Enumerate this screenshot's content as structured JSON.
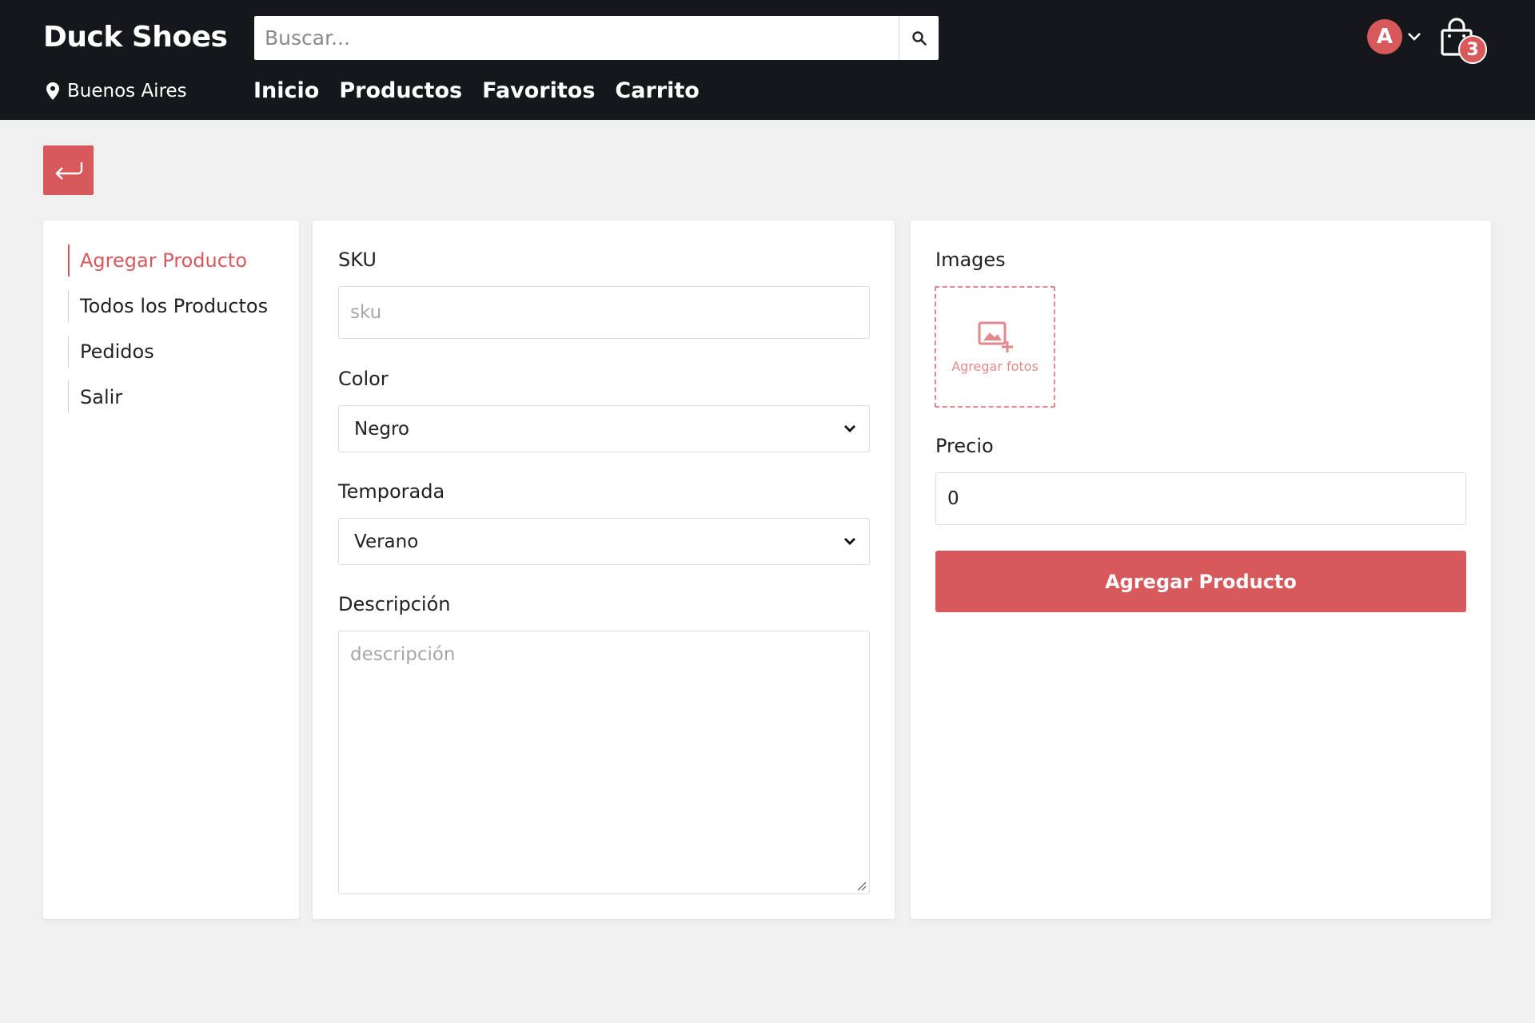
{
  "header": {
    "brand": "Duck Shoes",
    "search_placeholder": "Buscar...",
    "location": "Buenos Aires",
    "nav": [
      "Inicio",
      "Productos",
      "Favoritos",
      "Carrito"
    ],
    "avatar_letter": "A",
    "cart_count": "3",
    "icons": {
      "search": "search-icon",
      "location": "map-pin-icon",
      "cart": "shopping-bag-icon",
      "chevron": "chevron-down-icon"
    }
  },
  "sidebar": {
    "items": [
      {
        "label": "Agregar Producto",
        "active": true
      },
      {
        "label": "Todos los Productos",
        "active": false
      },
      {
        "label": "Pedidos",
        "active": false
      },
      {
        "label": "Salir",
        "active": false
      }
    ]
  },
  "form": {
    "sku_label": "SKU",
    "sku_placeholder": "sku",
    "color_label": "Color",
    "color_value": "Negro",
    "season_label": "Temporada",
    "season_value": "Verano",
    "description_label": "Descripción",
    "description_placeholder": "descripción",
    "images_label": "Images",
    "add_photos": "Agregar fotos",
    "price_label": "Precio",
    "price_value": "0",
    "submit_label": "Agregar Producto"
  },
  "colors": {
    "accent": "#d8595b",
    "header_bg": "#16171a",
    "page_bg": "#f0f0f0"
  }
}
